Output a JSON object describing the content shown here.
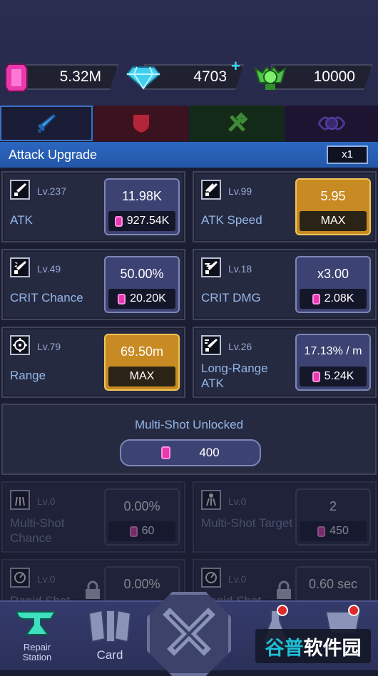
{
  "currencies": {
    "pink_gems": "5.32M",
    "diamonds": "4703",
    "diamonds_plus": "+",
    "green": "10000"
  },
  "section": {
    "title": "Attack Upgrade",
    "multiplier": "x1"
  },
  "cards": [
    {
      "level": "Lv.237",
      "name": "ATK",
      "value": "11.98K",
      "cost": "927.54K",
      "max": false
    },
    {
      "level": "Lv.99",
      "name": "ATK Speed",
      "value": "5.95",
      "cost": "MAX",
      "max": true
    },
    {
      "level": "Lv.49",
      "name": "CRIT Chance",
      "value": "50.00%",
      "cost": "20.20K",
      "max": false
    },
    {
      "level": "Lv.18",
      "name": "CRIT DMG",
      "value": "x3.00",
      "cost": "2.08K",
      "max": false
    },
    {
      "level": "Lv.79",
      "name": "Range",
      "value": "69.50m",
      "cost": "MAX",
      "max": true
    },
    {
      "level": "Lv.26",
      "name": "Long-Range ATK",
      "value": "17.13% / m",
      "cost": "5.24K",
      "max": false
    }
  ],
  "unlock": {
    "title": "Multi-Shot Unlocked",
    "cost": "400"
  },
  "locked_cards": [
    {
      "level": "Lv.0",
      "name": "Multi-Shot Chance",
      "value": "0.00%",
      "cost": "60"
    },
    {
      "level": "Lv.0",
      "name": "Multi-Shot Target",
      "value": "2",
      "cost": "450"
    },
    {
      "level": "Lv.0",
      "name": "Rapid Shot",
      "value": "0.00%",
      "cost": ""
    },
    {
      "level": "Lv.0",
      "name": "Rapid Shot",
      "value": "0.60 sec",
      "cost": ""
    }
  ],
  "nav": {
    "repair": "Repair Station",
    "card": "Card"
  },
  "watermark": {
    "part1": "谷普",
    "part2": "软件园"
  },
  "colors": {
    "accent": "#2b66c0",
    "max": "#c88a22",
    "gem": "#e93ab0"
  }
}
